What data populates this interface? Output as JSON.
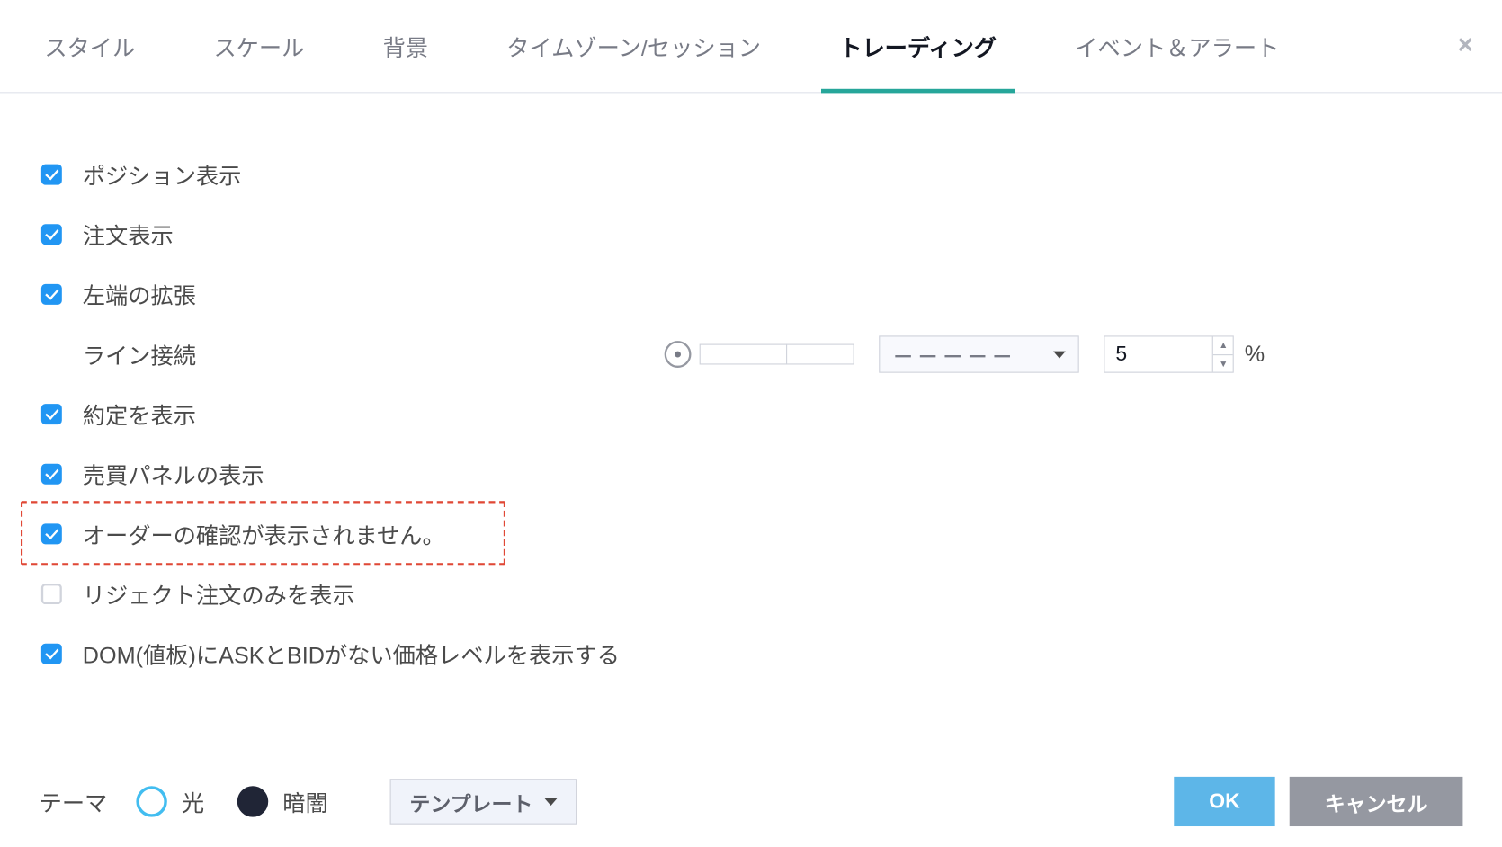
{
  "tabs": {
    "items": [
      "スタイル",
      "スケール",
      "背景",
      "タイムゾーン/セッション",
      "トレーディング",
      "イベント＆アラート"
    ],
    "active_index": 4
  },
  "options": [
    {
      "checked": true,
      "label": "ポジション表示"
    },
    {
      "checked": true,
      "label": "注文表示"
    },
    {
      "checked": true,
      "label": "左端の拡張"
    },
    {
      "checked": null,
      "label": "ライン接続",
      "has_line_controls": true
    },
    {
      "checked": true,
      "label": "約定を表示"
    },
    {
      "checked": true,
      "label": "売買パネルの表示"
    },
    {
      "checked": true,
      "label": "オーダーの確認が表示されません。",
      "highlighted": true
    },
    {
      "checked": false,
      "label": "リジェクト注文のみを表示"
    },
    {
      "checked": true,
      "label": "DOM(値板)にASKとBIDがない価格レベルを表示する"
    }
  ],
  "line_controls": {
    "style_display": "－－－－－",
    "value": "5",
    "unit": "%"
  },
  "footer": {
    "theme_label": "テーマ",
    "light_label": "光",
    "dark_label": "暗闇",
    "template_label": "テンプレート",
    "ok_label": "OK",
    "cancel_label": "キャンセル"
  }
}
